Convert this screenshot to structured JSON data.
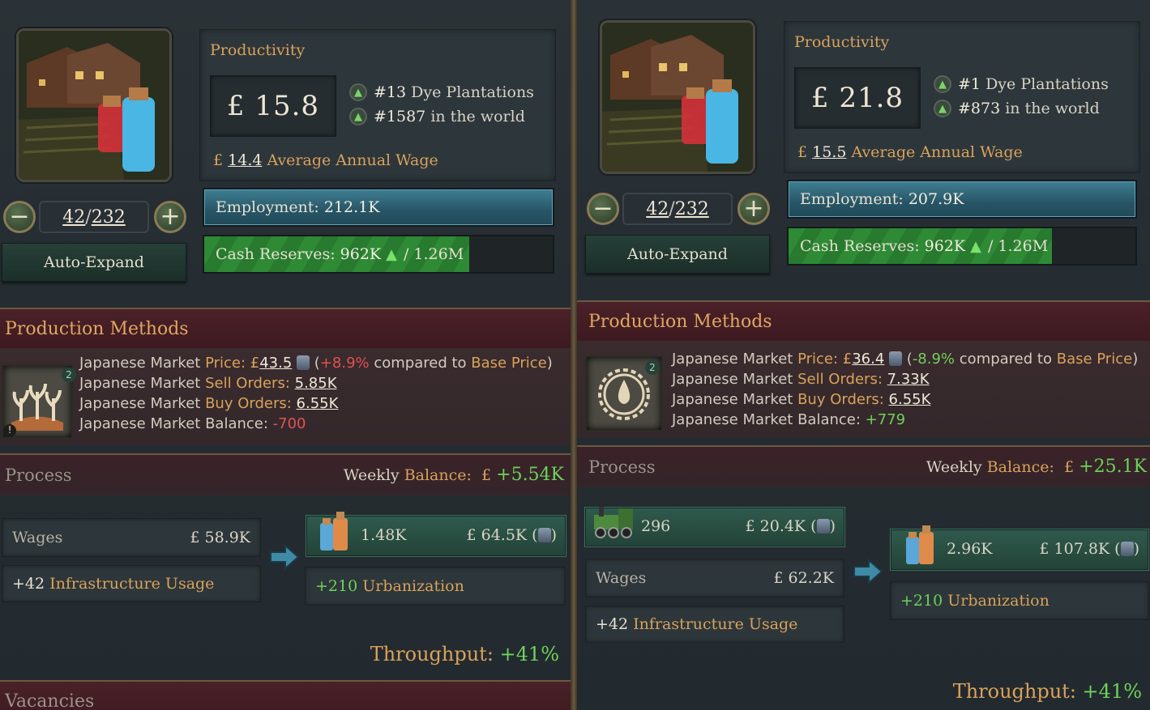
{
  "left": {
    "productivity": {
      "title": "Productivity",
      "value": "£ 15.8",
      "rank_type_num": "#13",
      "rank_type_label": "Dye Plantations",
      "rank_world_num": "#1587",
      "rank_world_label": "in the world",
      "wage_currency": "£",
      "wage_value": "14.4",
      "wage_label": "Average Annual Wage"
    },
    "level": {
      "minus": "−",
      "plus": "+",
      "current": "42",
      "separator": "/",
      "max": "232"
    },
    "auto_expand": "Auto-Expand",
    "employment": {
      "label": "Employment:",
      "value": "212.1K",
      "fill": 1.0
    },
    "cash": {
      "label": "Cash Reserves:",
      "value": "962K",
      "sep": "/",
      "max": "1.26M",
      "fill": 0.76
    },
    "production_methods_title": "Production Methods",
    "pm_badge": "2",
    "market": {
      "price_prefix": "Japanese Market ",
      "price_label": "Price:",
      "price_currency": "£",
      "price_value": "43.5",
      "price_change": "+8.9%",
      "price_compared": "compared to",
      "price_base": "Base Price",
      "price_open": "(",
      "price_close": ")",
      "sell_prefix": "Japanese Market ",
      "sell_label": "Sell Orders:",
      "sell_value": "5.85K",
      "buy_prefix": "Japanese Market ",
      "buy_label": "Buy Orders:",
      "buy_value": "6.55K",
      "bal_prefix": "Japanese Market ",
      "bal_label": "Balance:",
      "bal_value": "-700"
    },
    "process": {
      "title": "Process",
      "weekly_label_a": "Weekly ",
      "weekly_label_b": "Balance:",
      "weekly_currency": "£",
      "weekly_value": "+5.54K",
      "wages_label": "Wages",
      "wages_value": "£ 58.9K",
      "infra_value": "+42",
      "infra_label": "Infrastructure Usage",
      "output_qty": "1.48K",
      "output_value": "£ 64.5K (",
      "output_close": ")",
      "urb_value": "+210",
      "urb_label": "Urbanization"
    },
    "throughput": {
      "label": "Throughput:",
      "value": "+41%"
    },
    "vacancies": "Vacancies"
  },
  "right": {
    "productivity": {
      "title": "Productivity",
      "value": "£ 21.8",
      "rank_type_num": "#1",
      "rank_type_label": "Dye Plantations",
      "rank_world_num": "#873",
      "rank_world_label": "in the world",
      "wage_currency": "£",
      "wage_value": "15.5",
      "wage_label": "Average Annual Wage"
    },
    "level": {
      "minus": "−",
      "plus": "+",
      "current": "42",
      "separator": "/",
      "max": "232"
    },
    "auto_expand": "Auto-Expand",
    "employment": {
      "label": "Employment:",
      "value": "207.9K",
      "fill": 1.0
    },
    "cash": {
      "label": "Cash Reserves:",
      "value": "962K",
      "sep": "/",
      "max": "1.26M",
      "fill": 0.76
    },
    "production_methods_title": "Production Methods",
    "pm_badge": "2",
    "market": {
      "price_prefix": "Japanese Market ",
      "price_label": "Price:",
      "price_currency": "£",
      "price_value": "36.4",
      "price_change": "-8.9%",
      "price_compared": "compared to",
      "price_base": "Base Price",
      "price_open": "(",
      "price_close": ")",
      "sell_prefix": "Japanese Market ",
      "sell_label": "Sell Orders:",
      "sell_value": "7.33K",
      "buy_prefix": "Japanese Market ",
      "buy_label": "Buy Orders:",
      "buy_value": "6.55K",
      "bal_prefix": "Japanese Market ",
      "bal_label": "Balance:",
      "bal_value": "+779"
    },
    "process": {
      "title": "Process",
      "weekly_label_a": "Weekly ",
      "weekly_label_b": "Balance:",
      "weekly_currency": "£",
      "weekly_value": "+25.1K",
      "input_qty": "296",
      "input_value": "£ 20.4K (",
      "input_close": ")",
      "wages_label": "Wages",
      "wages_value": "£ 62.2K",
      "infra_value": "+42",
      "infra_label": "Infrastructure Usage",
      "output_qty": "2.96K",
      "output_value": "£ 107.8K (",
      "output_close": ")",
      "urb_value": "+210",
      "urb_label": "Urbanization"
    },
    "throughput": {
      "label": "Throughput:",
      "value": "+41%"
    }
  },
  "icons": {
    "rank": "up-arrow-icon",
    "level_minus": "minus-icon",
    "level_plus": "plus-icon",
    "silver": "silver-coins-icon",
    "dye": "dye-bottles-icon",
    "pm_left": "plants-icon",
    "pm_right": "dye-drop-gear-icon",
    "engine": "locomotive-icon"
  },
  "colors": {
    "accent_gold": "#d9a25b",
    "positive": "#72cf5a",
    "negative": "#e05252",
    "employment_bar": "#2f6b7e",
    "cash_bar": "#2f8a36",
    "section_header": "#4a2128"
  }
}
